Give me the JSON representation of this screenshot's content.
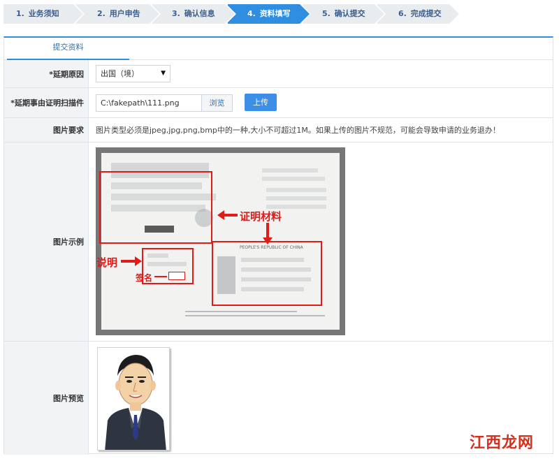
{
  "steps": [
    {
      "num": "1.",
      "label": "业务须知"
    },
    {
      "num": "2.",
      "label": "用户申告"
    },
    {
      "num": "3.",
      "label": "确认信息"
    },
    {
      "num": "4.",
      "label": "资料填写"
    },
    {
      "num": "5.",
      "label": "确认提交"
    },
    {
      "num": "6.",
      "label": "完成提交"
    }
  ],
  "tab": {
    "label": "提交资料"
  },
  "fields": {
    "reason": {
      "label": "*延期原因",
      "value": "出国（境）"
    },
    "scan": {
      "label": "*延期事由证明扫描件",
      "file": "C:\\fakepath\\111.png",
      "browse": "浏览",
      "upload": "上传"
    },
    "requirement": {
      "label": "图片要求",
      "text": "图片类型必须是jpeg,jpg,png,bmp中的一种,大小不可超过1M。如果上传的图片不规范，可能会导致申请的业务退办！"
    },
    "example": {
      "label": "图片示例",
      "annot_material": "证明材料",
      "annot_note": "说明",
      "annot_sign": "签名",
      "pp_header": "PEOPLE'S REPUBLIC OF CHINA"
    },
    "preview": {
      "label": "图片预览"
    }
  },
  "watermark": "江西龙网",
  "colors": {
    "accent": "#2f8ee0",
    "annotation": "#e11a1a"
  }
}
